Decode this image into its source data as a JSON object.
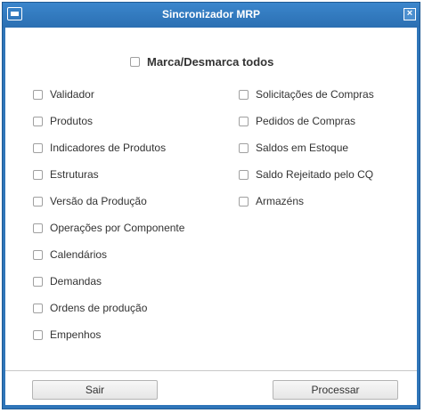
{
  "window": {
    "title": "Sincronizador MRP",
    "close_glyph": "×"
  },
  "toggle_all": {
    "label": "Marca/Desmarca todos",
    "checked": false
  },
  "options_left": [
    {
      "label": "Validador",
      "checked": false
    },
    {
      "label": "Produtos",
      "checked": false
    },
    {
      "label": "Indicadores de Produtos",
      "checked": false
    },
    {
      "label": "Estruturas",
      "checked": false
    },
    {
      "label": "Versão da Produção",
      "checked": false
    },
    {
      "label": "Operações por Componente",
      "checked": false
    },
    {
      "label": "Calendários",
      "checked": false
    },
    {
      "label": "Demandas",
      "checked": false
    },
    {
      "label": "Ordens de produção",
      "checked": false
    },
    {
      "label": "Empenhos",
      "checked": false
    }
  ],
  "options_right": [
    {
      "label": "Solicitações de Compras",
      "checked": false
    },
    {
      "label": "Pedidos de Compras",
      "checked": false
    },
    {
      "label": "Saldos em Estoque",
      "checked": false
    },
    {
      "label": "Saldo Rejeitado pelo CQ",
      "checked": false
    },
    {
      "label": "Armazéns",
      "checked": false
    }
  ],
  "buttons": {
    "cancel": "Sair",
    "process": "Processar"
  },
  "colors": {
    "titlebar": "#2f75b9",
    "text": "#333333",
    "checkbox_border": "#a0a0a0"
  }
}
